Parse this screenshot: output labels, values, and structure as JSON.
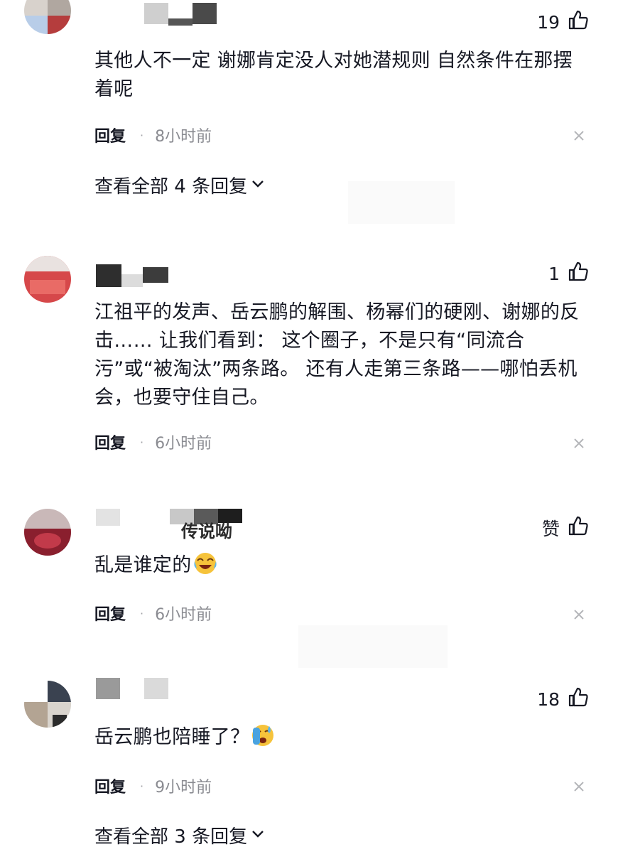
{
  "comments": [
    {
      "username_visible": "",
      "likes": "19",
      "text": "其他人不一定 谢娜肯定没人对她潜规则 自然条件在那摆着呢",
      "reply_label": "回复",
      "time": "8小时前",
      "view_all": "查看全部 4 条回复"
    },
    {
      "username_visible": "",
      "likes": "1",
      "text": "江祖平的发声、岳云鹏的解围、杨幂们的硬刚、谢娜的反击…… 让我们看到： 这个圈子，不是只有“同流合污”或“被淘汰”两条路。 还有人走第三条路——哪怕丢机会，也要守住自己。",
      "reply_label": "回复",
      "time": "6小时前"
    },
    {
      "username_visible": "传说呦",
      "likes": "赞",
      "text": "乱是谁定的",
      "emoji": "laughing-crying-emoji",
      "reply_label": "回复",
      "time": "6小时前"
    },
    {
      "username_visible": "",
      "likes": "18",
      "text": "岳云鹏也陪睡了？",
      "emoji": "sweating-face-emoji",
      "reply_label": "回复",
      "time": "9小时前",
      "view_all": "查看全部 3 条回复"
    }
  ],
  "colors": {
    "text": "#161823",
    "meta": "#8a8b91",
    "background": "#ffffff"
  }
}
